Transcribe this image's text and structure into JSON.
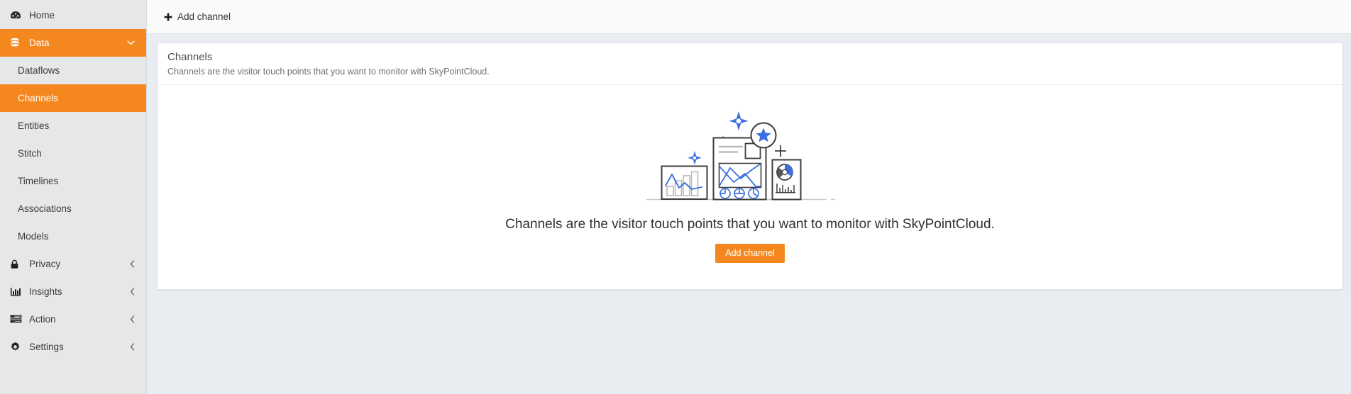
{
  "sidebar": {
    "items": [
      {
        "label": "Home",
        "icon": "dashboard-gauge-icon",
        "level": "top",
        "active": false,
        "chevron": ""
      },
      {
        "label": "Data",
        "icon": "database-icon",
        "level": "top",
        "active": true,
        "chevron": "⌄"
      },
      {
        "label": "Dataflows",
        "icon": "",
        "level": "child",
        "active": false,
        "chevron": ""
      },
      {
        "label": "Channels",
        "icon": "",
        "level": "child",
        "active": true,
        "chevron": ""
      },
      {
        "label": "Entities",
        "icon": "",
        "level": "child",
        "active": false,
        "chevron": ""
      },
      {
        "label": "Stitch",
        "icon": "",
        "level": "child",
        "active": false,
        "chevron": ""
      },
      {
        "label": "Timelines",
        "icon": "",
        "level": "child",
        "active": false,
        "chevron": ""
      },
      {
        "label": "Associations",
        "icon": "",
        "level": "child",
        "active": false,
        "chevron": ""
      },
      {
        "label": "Models",
        "icon": "",
        "level": "child",
        "active": false,
        "chevron": ""
      },
      {
        "label": "Privacy",
        "icon": "lock-icon",
        "level": "top",
        "active": false,
        "chevron": "‹"
      },
      {
        "label": "Insights",
        "icon": "bar-chart-icon",
        "level": "top",
        "active": false,
        "chevron": "‹"
      },
      {
        "label": "Action",
        "icon": "list-server-icon",
        "level": "top",
        "active": false,
        "chevron": "‹"
      },
      {
        "label": "Settings",
        "icon": "gear-icon",
        "level": "top",
        "active": false,
        "chevron": "‹"
      }
    ]
  },
  "toolbar": {
    "add_channel_label": "Add channel",
    "plus_glyph": "✚"
  },
  "card": {
    "title": "Channels",
    "subtitle": "Channels are the visitor touch points that you want to monitor with SkyPointCloud.",
    "empty_message": "Channels are the visitor touch points that you want to monitor with SkyPointCloud.",
    "primary_button_label": "Add channel",
    "illustration_name": "analytics-dashboards-empty-state-illustration"
  },
  "colors": {
    "accent_orange": "#f5871f",
    "illustration_blue": "#3d6fe0",
    "illustration_dark": "#3c3c3c",
    "illustration_gray": "#b4b4b4",
    "sidebar_bg": "#e6e7e8",
    "page_bg": "#e9ecf0",
    "card_bg": "#ffffff",
    "toolbar_bg": "#fafafa"
  }
}
